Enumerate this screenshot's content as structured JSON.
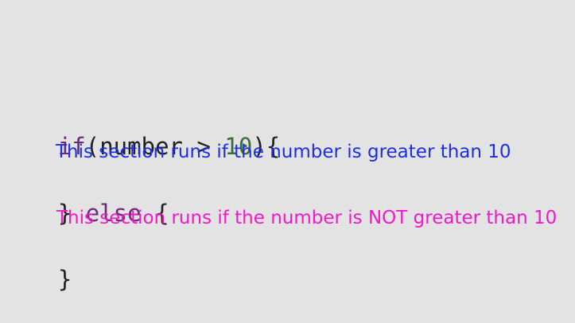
{
  "colors": {
    "background": "#e3e3e3",
    "keyword": "#6b2a7a",
    "number": "#3f6b3d",
    "plain_text": "#202020",
    "if_comment": "#1b2ee6",
    "else_comment": "#ef19c8"
  },
  "code": {
    "line_1": {
      "keyword": "if",
      "open": "(number > ",
      "number": "10",
      "close": "){"
    },
    "line_3": {
      "prefix": "} ",
      "keyword": "else",
      "suffix": " {"
    },
    "line_5": {
      "closing_brace": "}"
    }
  },
  "annotations": {
    "if_section": "This section runs if the number is greater than 10",
    "else_section": "This section runs if the number is NOT greater than 10"
  }
}
